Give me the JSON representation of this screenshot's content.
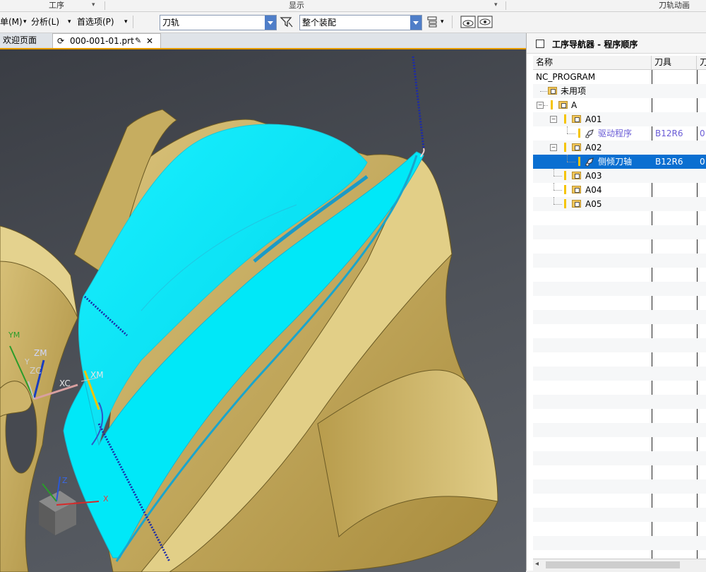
{
  "ribbon": {
    "groups": [
      "工序",
      "显示",
      "刀轨动画"
    ]
  },
  "toolbar": {
    "menus": [
      {
        "label": "单(M)"
      },
      {
        "label": "分析(L)"
      },
      {
        "label": "首选项(P)"
      }
    ],
    "combo_type": "刀轨",
    "combo_scope": "整个装配"
  },
  "tabs": [
    {
      "label": "欢迎页面"
    },
    {
      "label": "000-001-01.prt"
    }
  ],
  "viewport": {
    "labels": {
      "ym": "YM",
      "zm": "ZM",
      "zc": "ZC",
      "yc": "Y",
      "xc": "XC",
      "xm": "XM",
      "z": "Z",
      "x": "X"
    }
  },
  "navigator": {
    "title": "工序导航器 - 程序顺序",
    "columns": [
      "名称",
      "刀具",
      "刀"
    ],
    "rows": [
      {
        "name": "NC_PROGRAM",
        "tool": "",
        "order": ""
      },
      {
        "name": "未用项",
        "tool": "",
        "order": ""
      },
      {
        "name": "A",
        "tool": "",
        "order": ""
      },
      {
        "name": "A01",
        "tool": "",
        "order": ""
      },
      {
        "name": "驱动程序",
        "tool": "B12R6",
        "order": "0"
      },
      {
        "name": "A02",
        "tool": "",
        "order": ""
      },
      {
        "name": "侧倾刀轴",
        "tool": "B12R6",
        "order": "0"
      },
      {
        "name": "A03",
        "tool": "",
        "order": ""
      },
      {
        "name": "A04",
        "tool": "",
        "order": ""
      },
      {
        "name": "A05",
        "tool": "",
        "order": ""
      }
    ]
  },
  "colors": {
    "accent": "#0a6fd1",
    "toolpath": "#00e5ff",
    "part": "#c8b163",
    "selection": "#0a6fd1"
  }
}
